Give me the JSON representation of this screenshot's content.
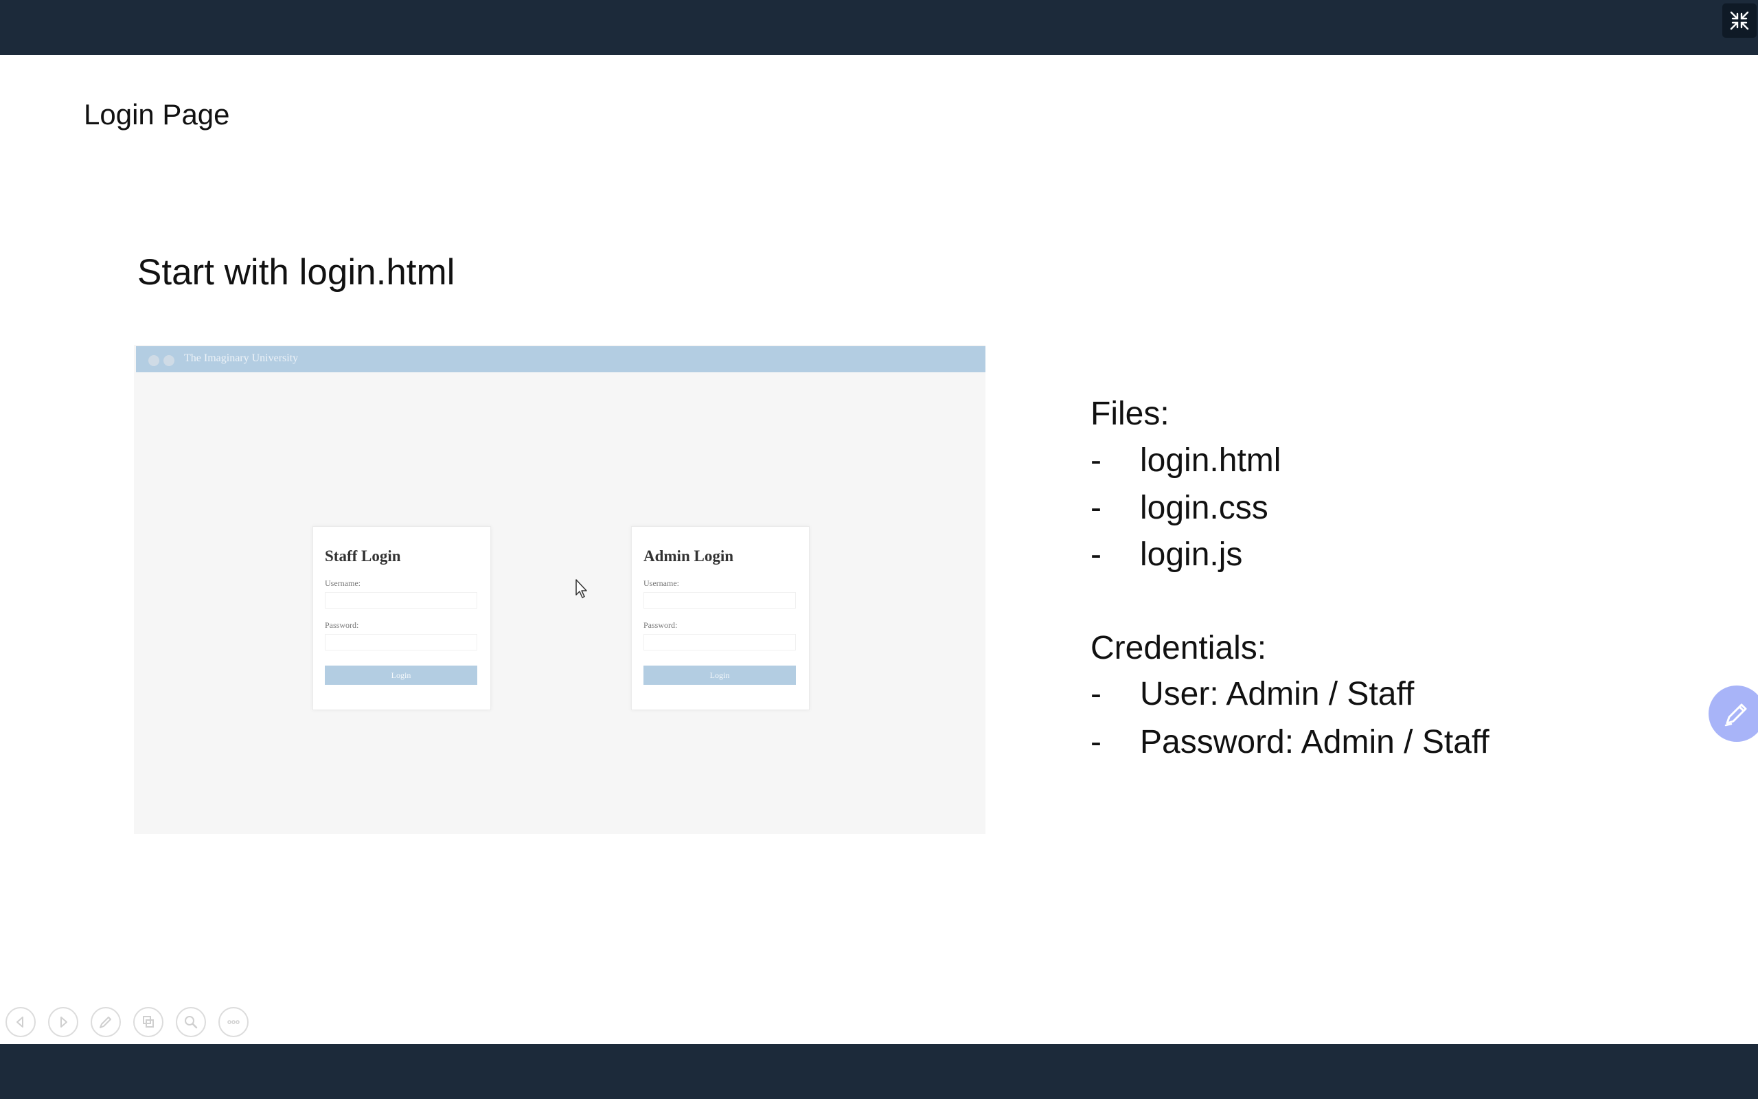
{
  "slide": {
    "page_title": "Login Page",
    "heading": "Start with login.html"
  },
  "mockup": {
    "app_title": "The Imaginary University",
    "staff_card": {
      "title": "Staff Login",
      "username_label": "Username:",
      "password_label": "Password:",
      "button_label": "Login"
    },
    "admin_card": {
      "title": "Admin Login",
      "username_label": "Username:",
      "password_label": "Password:",
      "button_label": "Login"
    }
  },
  "files": {
    "heading": "Files:",
    "items": [
      {
        "dash": "-",
        "text": "login.html"
      },
      {
        "dash": "-",
        "text": "login.css"
      },
      {
        "dash": "-",
        "text": "login.js"
      }
    ]
  },
  "credentials": {
    "heading": "Credentials:",
    "items": [
      {
        "dash": "-",
        "text": "User: Admin / Staff"
      },
      {
        "dash": "-",
        "text": "Password: Admin / Staff"
      }
    ]
  },
  "icons": {
    "exit_fullscreen": "exit-fullscreen-icon",
    "pen": "pen-icon",
    "prev": "previous-slide-icon",
    "next": "next-slide-icon",
    "annotate": "pen-tool-icon",
    "slides": "see-all-slides-icon",
    "zoom": "zoom-icon",
    "more": "more-options-icon"
  },
  "colors": {
    "chrome": "#1c2a3a",
    "mockup_accent": "#b3cde2",
    "pen_bubble": "#a8b4f8"
  }
}
